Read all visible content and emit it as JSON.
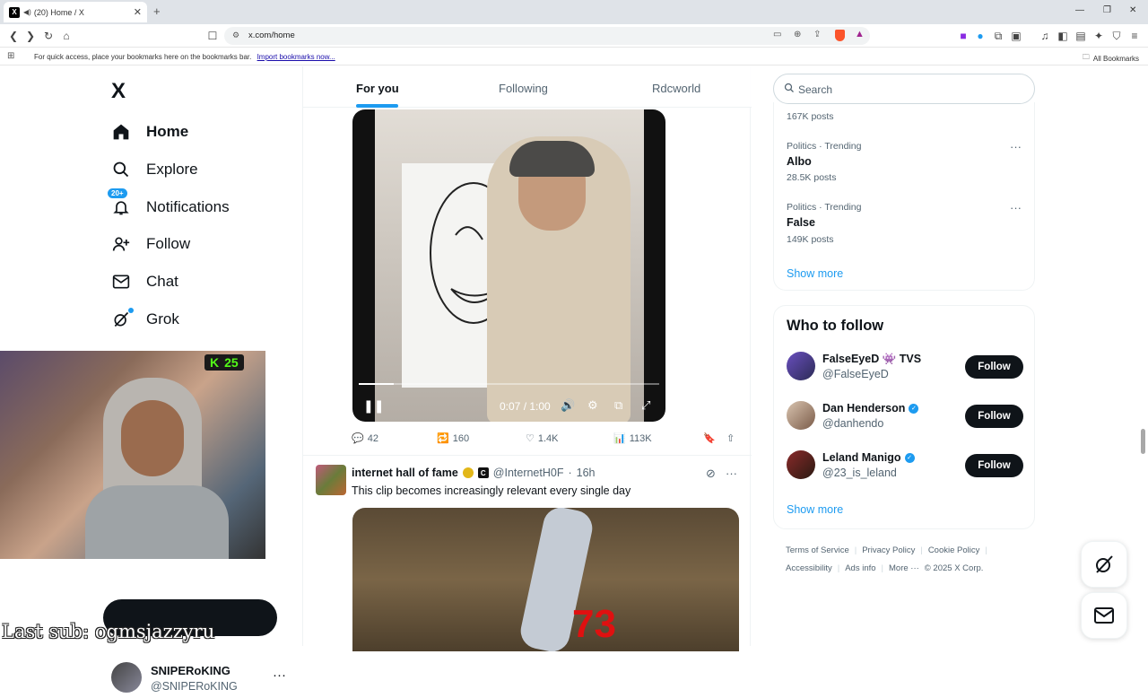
{
  "browser": {
    "tab_title": "(20) Home / X",
    "url": "x.com/home",
    "bookmarks_hint": "For quick access, place your bookmarks here on the bookmarks bar.",
    "import_link": "Import bookmarks now...",
    "all_bookmarks": "All Bookmarks"
  },
  "sidebar": {
    "logo": "X",
    "items": [
      {
        "label": "Home",
        "icon": "home-icon"
      },
      {
        "label": "Explore",
        "icon": "search-icon"
      },
      {
        "label": "Notifications",
        "icon": "bell-icon",
        "badge": "20+"
      },
      {
        "label": "Follow",
        "icon": "add-person-icon"
      },
      {
        "label": "Chat",
        "icon": "mail-icon"
      },
      {
        "label": "Grok",
        "icon": "grok-icon"
      }
    ],
    "account": {
      "name": "SNIPERoKING",
      "handle": "@SNIPERoKING"
    }
  },
  "overlay": {
    "kick_followers": "25",
    "last_sub": "Last sub: ogmsjazzyru"
  },
  "feed": {
    "tabs": [
      {
        "label": "For you",
        "selected": true
      },
      {
        "label": "Following",
        "selected": false
      },
      {
        "label": "Rdcworld",
        "selected": false
      }
    ],
    "video": {
      "time": "0:07 / 1:00",
      "progress": 0.117
    },
    "actions": {
      "replies": "42",
      "reposts": "160",
      "likes": "1.4K",
      "views": "113K"
    },
    "post2": {
      "name": "internet hall of fame",
      "handle": "@InternetH0F",
      "time": "16h",
      "text": "This clip becomes increasingly relevant every single day",
      "overlay_number": "73"
    }
  },
  "right": {
    "search_placeholder": "Search",
    "trends": [
      {
        "posts": "167K posts"
      },
      {
        "context": "Politics · Trending",
        "name": "Albo",
        "posts": "28.5K posts"
      },
      {
        "context": "Politics · Trending",
        "name": "False",
        "posts": "149K posts"
      }
    ],
    "show_more": "Show more",
    "who_to_follow": {
      "title": "Who to follow",
      "people": [
        {
          "name": "FalseEyeD 👾 TVS",
          "handle": "@FalseEyeD",
          "button": "Follow"
        },
        {
          "name": "Dan Henderson",
          "handle": "@danhendo",
          "button": "Follow"
        },
        {
          "name": "Leland Manigo",
          "handle": "@23_is_leland",
          "button": "Follow"
        }
      ],
      "show_more": "Show more"
    },
    "footer": {
      "terms": "Terms of Service",
      "privacy": "Privacy Policy",
      "cookie": "Cookie Policy",
      "accessibility": "Accessibility",
      "ads": "Ads info",
      "more": "More ···",
      "copyright": "© 2025 X Corp."
    }
  },
  "colors": {
    "accent": "#1d9bf0",
    "text": "#0f1419",
    "secondary": "#536471"
  }
}
